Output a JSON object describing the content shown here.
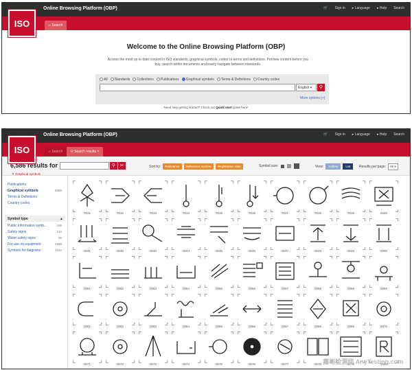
{
  "app": {
    "logo_text": "ISO",
    "title": "Online Browsing Platform (OBP)",
    "nav": [
      "Sign in",
      "Language",
      "Help",
      "Search"
    ]
  },
  "panel1": {
    "tab_search": "Search",
    "welcome": "Welcome to the Online Browsing Platform (OBP)",
    "description": "Access the most up to date content in ISO standards, graphical symbols, codes or terms and definitions. Preview content before you buy, search within documents and easily navigate between standards.",
    "categories": [
      "All",
      "Standards",
      "Collections",
      "Publications",
      "Graphical symbols",
      "Terms & Definitions",
      "Country codes"
    ],
    "selected_category": "Graphical symbols",
    "search_value": "",
    "language": "English",
    "more_options": "More options [+]",
    "help_text": "Need help getting started? Check our",
    "help_link": "Quick start",
    "help_suffix": "guide here!"
  },
  "panel2": {
    "tab_search": "Search",
    "tab_results": "Search results",
    "results_count": "6,586 results for",
    "search_value": "",
    "filter_tag": "Graphical symbols",
    "sort_by": "Sort by:",
    "sort_buttons": [
      "Relevance",
      "Reference number",
      "Registration date"
    ],
    "symbol_size": "Symbol size:",
    "view_label": "View:",
    "view_buttons": [
      "Gallery",
      "List"
    ],
    "results_per_page": "Results per page:",
    "results_per_page_value": "60",
    "sidebar": {
      "items": [
        {
          "label": "Publications",
          "count": ""
        },
        {
          "label": "Graphical symbols",
          "count": "6586"
        },
        {
          "label": "Terms & Definitions",
          "count": ""
        },
        {
          "label": "Country codes",
          "count": ""
        }
      ],
      "symbol_type_header": "Symbol type",
      "symbol_types": [
        {
          "label": "Public information symb...",
          "count": "168"
        },
        {
          "label": "Safety signs",
          "count": "216"
        },
        {
          "label": "Water safety signs",
          "count": "50"
        },
        {
          "label": "For use on equipment",
          "count": "4988"
        },
        {
          "label": "Symbols for diagrams",
          "count": "1164"
        }
      ]
    },
    "symbols": [
      "0031",
      "0032",
      "0033",
      "0034",
      "0035",
      "0036",
      "0037",
      "0038",
      "0039",
      "0040",
      "0041",
      "0042",
      "0043",
      "0044",
      "0045",
      "0046",
      "0047",
      "0048",
      "0049",
      "0050",
      "0051",
      "0052",
      "0053",
      "0054",
      "0055",
      "0056",
      "0057",
      "0058",
      "0059",
      "0060",
      "0061",
      "0062",
      "0063",
      "0064",
      "0065",
      "0066",
      "0067",
      "0068",
      "0069",
      "0070",
      "0071",
      "0072",
      "0073",
      "0074",
      "0075",
      "0076",
      "0077",
      "0078",
      "0079",
      "0080"
    ],
    "watermark": "嘉峪检测网 AnyTesting.com"
  }
}
